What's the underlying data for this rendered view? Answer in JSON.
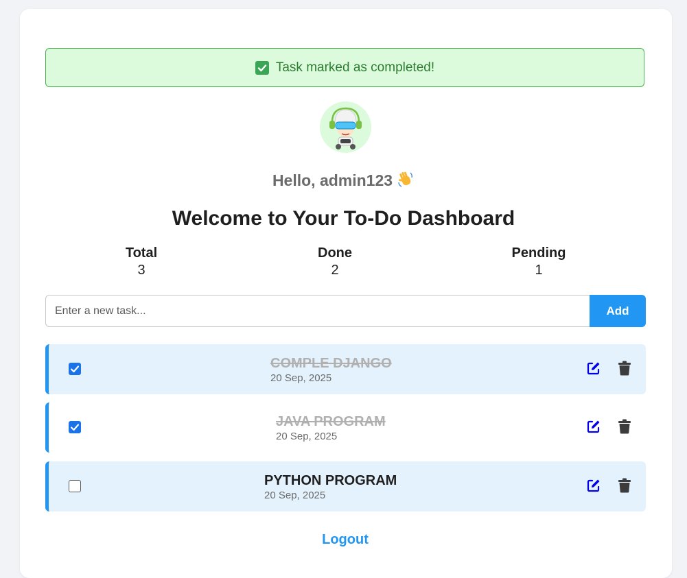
{
  "alert": {
    "message": "Task marked as completed!",
    "icon": "check-box-emoji"
  },
  "user": {
    "greeting": "Hello, admin123",
    "wave_icon": "waving-hand-emoji"
  },
  "dashboard": {
    "title": "Welcome to Your To-Do Dashboard"
  },
  "stats": {
    "total": {
      "label": "Total",
      "value": "3"
    },
    "done": {
      "label": "Done",
      "value": "2"
    },
    "pending": {
      "label": "Pending",
      "value": "1"
    }
  },
  "new_task": {
    "placeholder": "Enter a new task...",
    "add_label": "Add"
  },
  "tasks": [
    {
      "name": "COMPLE DJANGO",
      "date": "20 Sep, 2025",
      "completed": true
    },
    {
      "name": "JAVA PROGRAM",
      "date": "20 Sep, 2025",
      "completed": true
    },
    {
      "name": "PYTHON PROGRAM",
      "date": "20 Sep, 2025",
      "completed": false
    }
  ],
  "logout_label": "Logout",
  "colors": {
    "accent": "#2196f3",
    "success_bg": "#dcfbdc",
    "success_text": "#2e7d32",
    "row_highlight": "#e3f2fd",
    "icon_edit": "#0000ee"
  }
}
